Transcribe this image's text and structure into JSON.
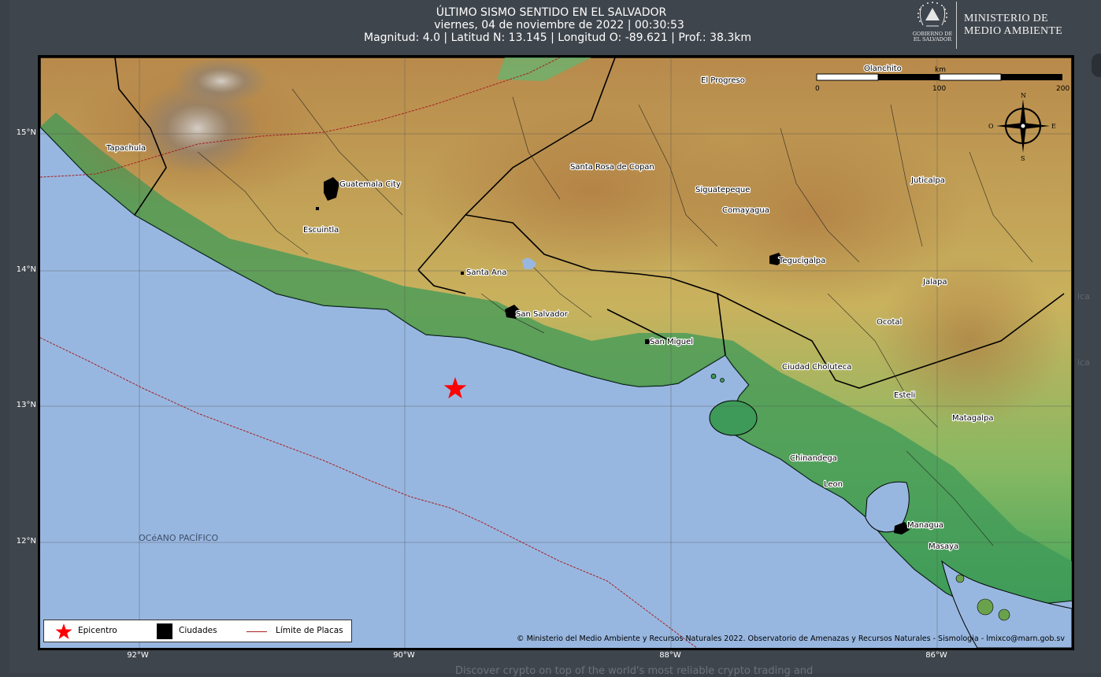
{
  "header": {
    "title": "ÚLTIMO SISMO SENTIDO EN EL SALVADOR",
    "datetime": "viernes, 04 de noviembre de 2022 | 00:30:53",
    "details": "Magnitud: 4.0 | Latitud N: 13.145 | Longitud O: -89.621 | Prof.: 38.3km"
  },
  "logo": {
    "gobierno_line1": "GOBIERNO DE",
    "gobierno_line2": "EL SALVADOR",
    "ministerio_line1": "MINISTERIO DE",
    "ministerio_line2": "MEDIO AMBIENTE"
  },
  "map": {
    "lat_labels": [
      "15°N",
      "14°N",
      "13°N",
      "12°N"
    ],
    "lon_labels": [
      "92°W",
      "90°W",
      "88°W",
      "86°W"
    ],
    "ocean_label": "OCéANO PACÍFICO",
    "cities": [
      "Tapachula",
      "Guatemala City",
      "Escuintla",
      "Santa Ana",
      "San Salvador",
      "San Miguel",
      "Santa Rosa de Copan",
      "Siguatepeque",
      "Comayagua",
      "Tegucigalpa",
      "El Progreso",
      "Olanchito",
      "Juticalpa",
      "Jalapa",
      "Ocotal",
      "Ciudad Choluteca",
      "Esteli",
      "Matagalpa",
      "Chinandega",
      "Leon",
      "Managua",
      "Masaya"
    ],
    "epicenter": {
      "lat": 13.145,
      "lon": -89.621
    },
    "colors": {
      "ocean": "#98b7e0",
      "epicenter": "#ff0000",
      "plate_boundary": "#a52020"
    }
  },
  "scalebar": {
    "unit": "km",
    "ticks": [
      "0",
      "100",
      "200"
    ]
  },
  "compass": {
    "n": "N",
    "s": "S",
    "e": "E",
    "w": "O"
  },
  "legend": {
    "epicentro": "Epicentro",
    "ciudades": "Ciudades",
    "limite": "Límite de Placas"
  },
  "credit": "© Ministerio del Medio Ambiente y Recursos Naturales 2022. Observatorio de Amenazas y Recursos Naturales - Sismologia - lmixco@marn.gob.sv"
}
